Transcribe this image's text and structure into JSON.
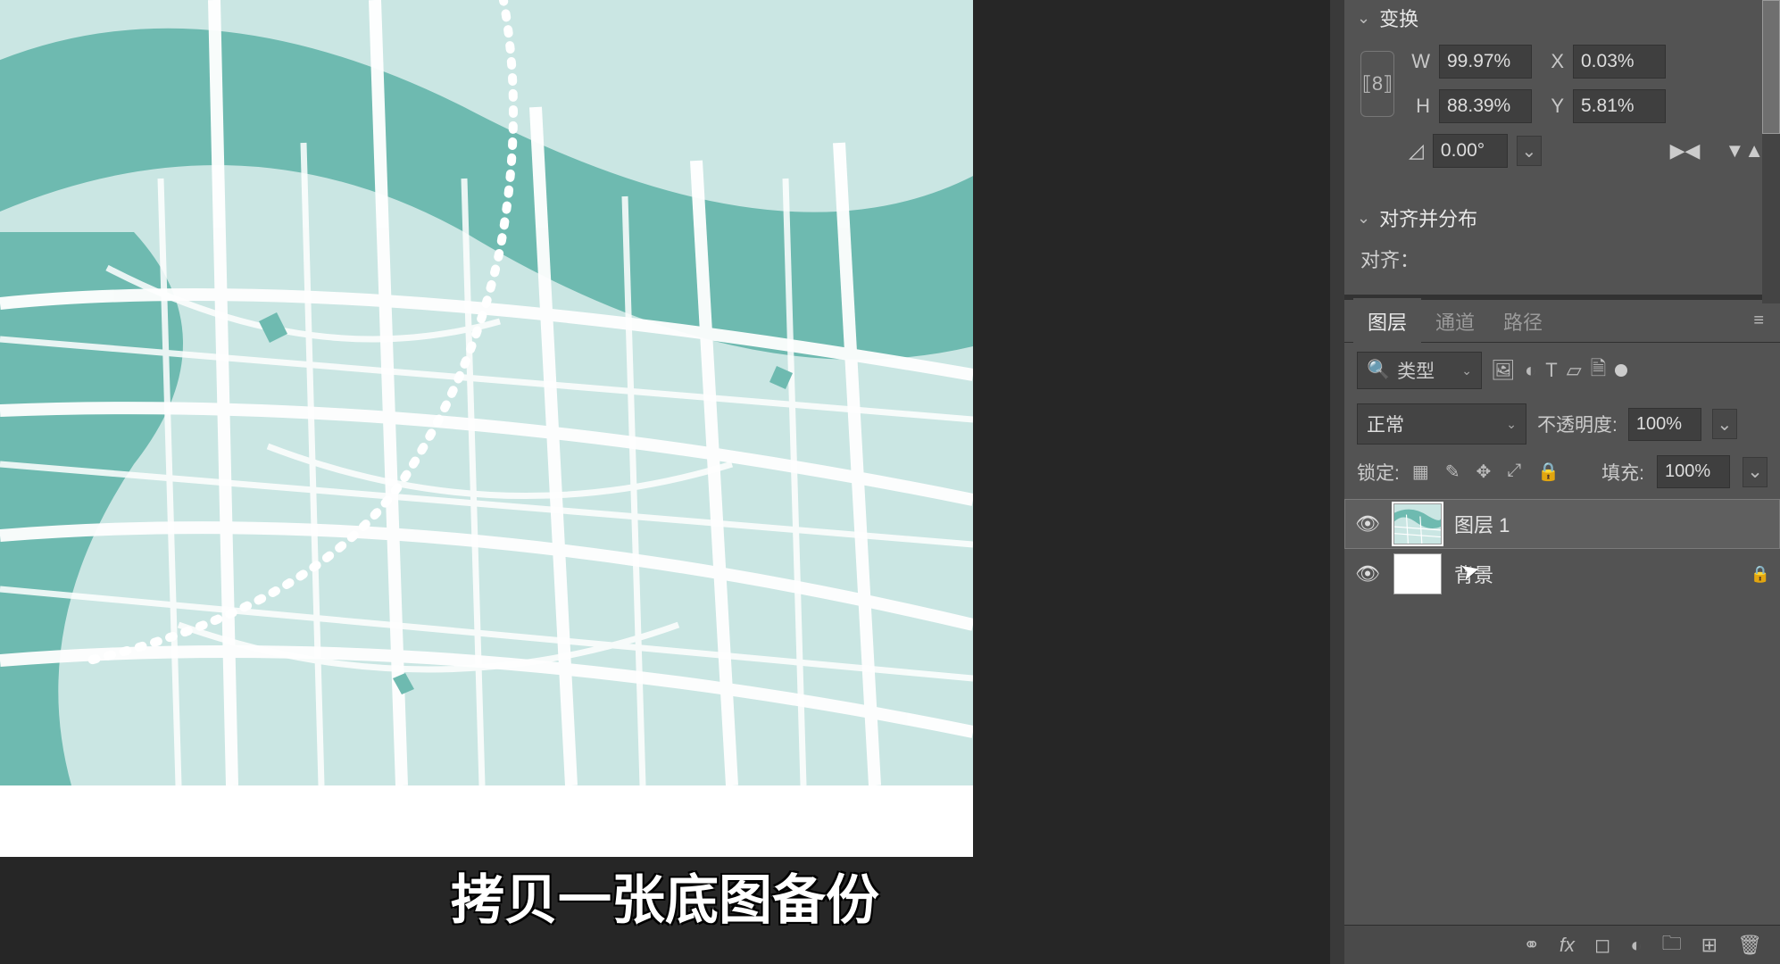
{
  "caption": "拷贝一张底图备份",
  "properties": {
    "transform": {
      "title": "变换",
      "w_label": "W",
      "w_value": "99.97%",
      "x_label": "X",
      "x_value": "0.03%",
      "h_label": "H",
      "h_value": "88.39%",
      "y_label": "Y",
      "y_value": "5.81%",
      "angle_value": "0.00°"
    },
    "align": {
      "title": "对齐并分布",
      "align_label": "对齐："
    }
  },
  "layers_panel": {
    "tabs": {
      "layers": "图层",
      "channels": "通道",
      "paths": "路径"
    },
    "filter_kind": "类型",
    "blend_mode": "正常",
    "opacity_label": "不透明度:",
    "opacity_value": "100%",
    "lock_label": "锁定:",
    "fill_label": "填充:",
    "fill_value": "100%",
    "layers": [
      {
        "name": "图层 1",
        "visible": true,
        "selected": true,
        "locked": false
      },
      {
        "name": "背景",
        "visible": true,
        "selected": false,
        "locked": true
      }
    ]
  }
}
